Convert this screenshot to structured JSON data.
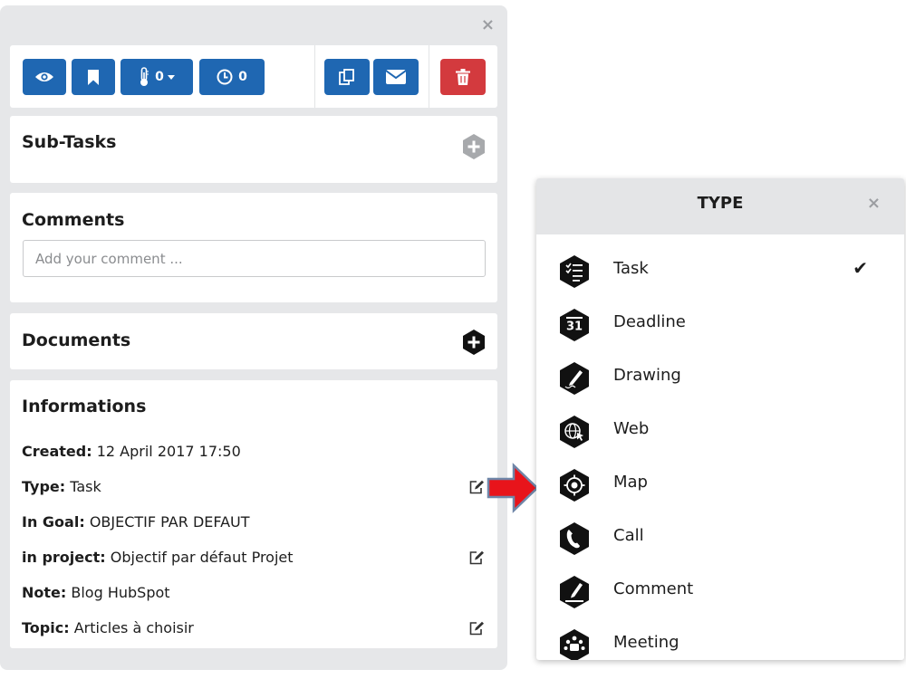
{
  "task_panel": {
    "close_glyph": "×",
    "toolbar": {
      "temperature_count": "0",
      "timer_count": "0"
    },
    "subtasks": {
      "title": "Sub-Tasks"
    },
    "comments": {
      "title": "Comments",
      "placeholder": "Add your comment ..."
    },
    "documents": {
      "title": "Documents"
    },
    "informations": {
      "title": "Informations",
      "rows": [
        {
          "label": "Created:",
          "value": "12 April 2017 17:50"
        },
        {
          "label": "Type:",
          "value": "Task"
        },
        {
          "label": "In Goal:",
          "value": "OBJECTIF PAR DEFAUT"
        },
        {
          "label": "in project:",
          "value": "Objectif par défaut Projet"
        },
        {
          "label": "Note:",
          "value": "Blog HubSpot"
        },
        {
          "label": "Topic:",
          "value": "Articles à choisir"
        }
      ]
    }
  },
  "type_panel": {
    "title": "TYPE",
    "close_glyph": "×",
    "selected_mark": "✔",
    "items": [
      {
        "label": "Task",
        "icon": "task-list-icon",
        "selected": true
      },
      {
        "label": "Deadline",
        "icon": "calendar-31-icon",
        "selected": false
      },
      {
        "label": "Drawing",
        "icon": "pencil-drawing-icon",
        "selected": false
      },
      {
        "label": "Web",
        "icon": "globe-cursor-icon",
        "selected": false
      },
      {
        "label": "Map",
        "icon": "map-target-icon",
        "selected": false
      },
      {
        "label": "Call",
        "icon": "phone-icon",
        "selected": false
      },
      {
        "label": "Comment",
        "icon": "pen-comment-icon",
        "selected": false
      },
      {
        "label": "Meeting",
        "icon": "meeting-people-icon",
        "selected": false
      }
    ]
  },
  "colors": {
    "primary_button": "#1f67b2",
    "danger_button": "#d33a3e",
    "arrow": "#e8141b",
    "panel_background": "#e6e7e9"
  }
}
